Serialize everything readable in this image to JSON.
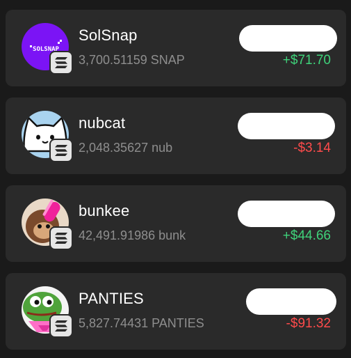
{
  "tokens": [
    {
      "name": "SolSnap",
      "balance": "3,700.51159 SNAP",
      "change": "+$71.70",
      "direction": "up",
      "logo_text": "SOLSNAP",
      "avatar_icon": "solsnap-logo-icon",
      "chain_icon": "solana-icon"
    },
    {
      "name": "nubcat",
      "balance": "2,048.35627 nub",
      "change": "-$3.14",
      "direction": "down",
      "avatar_icon": "nubcat-cat-icon",
      "chain_icon": "solana-icon"
    },
    {
      "name": "bunkee",
      "balance": "42,491.91986 bunk",
      "change": "+$44.66",
      "direction": "up",
      "avatar_icon": "bunkee-monkey-icon",
      "chain_icon": "solana-icon"
    },
    {
      "name": "PANTIES",
      "balance": "5,827.74431 PANTIES",
      "change": "-$91.32",
      "direction": "down",
      "avatar_icon": "pepe-frog-icon",
      "chain_icon": "solana-icon"
    }
  ],
  "colors": {
    "background": "#1a1a1a",
    "card": "#2a2a2a",
    "positive": "#3fd27a",
    "negative": "#ff4b4b",
    "solsnap_purple": "#7b14f5",
    "nubcat_blue": "#a9d3ef",
    "pepe_green": "#4fa33b"
  }
}
